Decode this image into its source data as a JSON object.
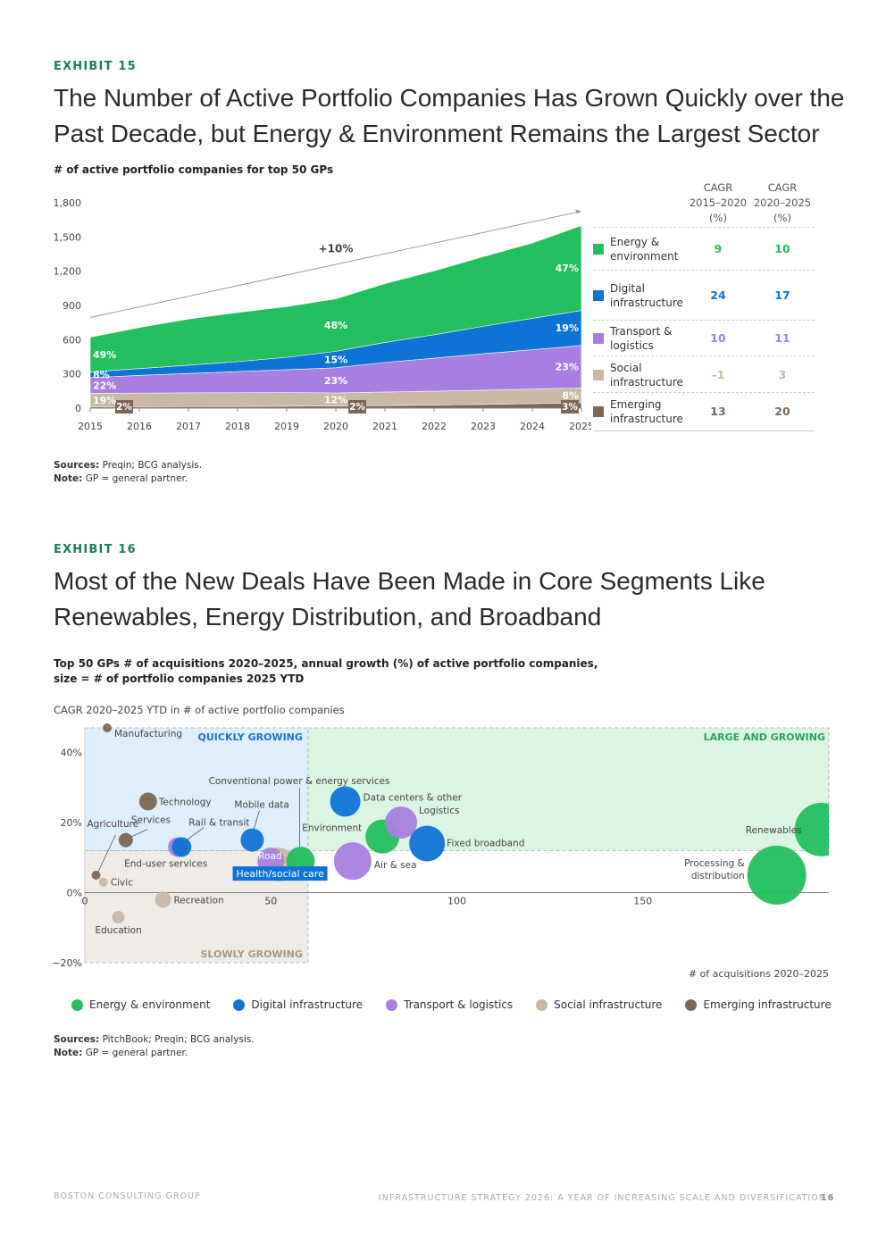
{
  "exhibit15": {
    "tag": "EXHIBIT 15",
    "title_line1": "The Number of Active Portfolio Companies Has Grown Quickly over the",
    "title_line2": "Past Decade, but Energy & Environment Remains the Largest Sector",
    "subtitle": "# of active portfolio companies for top 50 GPs",
    "growth_label": "+10%",
    "table_headers": [
      {
        "l1": "CAGR",
        "l2": "2015–2020",
        "l3": "(%)"
      },
      {
        "l1": "CAGR",
        "l2": "2020–2025",
        "l3": "(%)"
      }
    ],
    "table_rows": [
      {
        "l1": "Energy &",
        "l2": "environment",
        "c1": "9",
        "c2": "10",
        "color": "#22bf5e"
      },
      {
        "l1": "Digital",
        "l2": "infrastructure",
        "c1": "24",
        "c2": "17",
        "color": "#0e73d6"
      },
      {
        "l1": "Transport &",
        "l2": "logistics",
        "c1": "10",
        "c2": "11",
        "color": "#a87fe0"
      },
      {
        "l1": "Social",
        "l2": "infrastructure",
        "c1": "–1",
        "c2": "3",
        "color": "#c8b8a4"
      },
      {
        "l1": "Emerging",
        "l2": "infrastructure",
        "c1": "13",
        "c2": "20",
        "color": "#7d6654"
      }
    ],
    "sources_label": "Sources:",
    "sources_text": "Preqin; BCG analysis.",
    "note_label": "Note:",
    "note_text": "GP = general partner."
  },
  "exhibit16": {
    "tag": "EXHIBIT 16",
    "title_line1": "Most of the New Deals Have Been Made in Core Segments Like",
    "title_line2": "Renewables, Energy Distribution, and Broadband",
    "subtitle_line1": "Top 50 GPs # of acquisitions 2020–2025, annual growth (%) of active portfolio companies,",
    "subtitle_line2": "size = # of portfolio companies 2025 YTD",
    "y_axis_title": "CAGR 2020–2025 YTD in # of active portfolio companies",
    "x_axis_title": "# of acquisitions 2020–2025",
    "zone_quick": "QUICKLY GROWING",
    "zone_large": "LARGE AND GROWING",
    "zone_slow": "SLOWLY GROWING",
    "legend": [
      {
        "label": "Energy & environment",
        "color": "#22bf5e"
      },
      {
        "label": "Digital infrastructure",
        "color": "#0e73d6"
      },
      {
        "label": "Transport & logistics",
        "color": "#a87fe0"
      },
      {
        "label": "Social infrastructure",
        "color": "#c8b8a4"
      },
      {
        "label": "Emerging infrastructure",
        "color": "#7d6654"
      }
    ],
    "sources_label": "Sources:",
    "sources_text": "PitchBook; Preqin; BCG analysis.",
    "note_label": "Note:",
    "note_text": "GP = general partner."
  },
  "footer": {
    "left": "BOSTON CONSULTING GROUP",
    "right": "INFRASTRUCTURE STRATEGY 2026: A YEAR OF INCREASING SCALE AND DIVERSIFICATION",
    "page": "16"
  },
  "chart_data": [
    {
      "type": "area",
      "stacked": true,
      "x": [
        2015,
        2016,
        2017,
        2018,
        2019,
        2020,
        2021,
        2022,
        2023,
        2024,
        2025
      ],
      "ylim": [
        0,
        1800
      ],
      "yticks": [
        0,
        300,
        600,
        900,
        1200,
        1500,
        1800
      ],
      "ytick_labels": [
        "0",
        "300",
        "600",
        "900",
        "1,200",
        "1,500",
        "1,800"
      ],
      "grid": false,
      "series": [
        {
          "name": "Emerging infrastructure",
          "color": "#7d6654",
          "values": [
            12,
            13,
            14,
            15,
            17,
            19,
            23,
            27,
            33,
            40,
            48
          ],
          "labels": {
            "2015": "2%",
            "2020": "2%",
            "2025": "3%"
          }
        },
        {
          "name": "Social infrastructure",
          "color": "#c8b8a4",
          "values": [
            118,
            119,
            120,
            120,
            120,
            114,
            118,
            121,
            124,
            127,
            129
          ],
          "labels": {
            "2015": "19%",
            "2020": "12%",
            "2025": "8%"
          }
        },
        {
          "name": "Transport & logistics",
          "color": "#a87fe0",
          "values": [
            137,
            155,
            170,
            185,
            200,
            221,
            260,
            290,
            320,
            345,
            372
          ],
          "labels": {
            "2015": "22%",
            "2020": "23%",
            "2025": "23%"
          }
        },
        {
          "name": "Digital infrastructure",
          "color": "#0e73d6",
          "values": [
            50,
            60,
            72,
            88,
            108,
            144,
            175,
            205,
            240,
            275,
            307
          ],
          "labels": {
            "2015": "8%",
            "2020": "15%",
            "2025": "19%"
          }
        },
        {
          "name": "Energy & environment",
          "color": "#22bf5e",
          "values": [
            305,
            360,
            405,
            430,
            445,
            460,
            515,
            560,
            610,
            660,
            744
          ],
          "labels": {
            "2015": "49%",
            "2020": "48%",
            "2025": "47%"
          }
        }
      ],
      "annotation": "+10%"
    },
    {
      "type": "scatter",
      "bubble": true,
      "xlabel": "# of acquisitions 2020–2025",
      "ylabel": "CAGR 2020–2025 YTD in # of active portfolio companies",
      "xlim": [
        0,
        200
      ],
      "ylim": [
        -20,
        47
      ],
      "xticks": [
        0,
        50,
        100,
        150
      ],
      "yticks": [
        -20,
        0,
        20,
        40
      ],
      "ytick_labels": [
        "−20%",
        "0%",
        "20%",
        "40%"
      ],
      "points": [
        {
          "label": "Manufacturing",
          "sector": "Emerging infrastructure",
          "x": 6,
          "y": 47,
          "size": 5
        },
        {
          "label": "Technology",
          "sector": "Emerging infrastructure",
          "x": 17,
          "y": 26,
          "size": 10
        },
        {
          "label": "Agriculture",
          "sector": "Emerging infrastructure",
          "x": 3,
          "y": 5,
          "size": 5
        },
        {
          "label": "Services",
          "sector": "Emerging infrastructure",
          "x": 11,
          "y": 15,
          "size": 8
        },
        {
          "label": "Civic",
          "sector": "Social infrastructure",
          "x": 5,
          "y": 3,
          "size": 5
        },
        {
          "label": "Education",
          "sector": "Social infrastructure",
          "x": 9,
          "y": -7,
          "size": 7
        },
        {
          "label": "Recreation",
          "sector": "Social infrastructure",
          "x": 21,
          "y": -2,
          "size": 9
        },
        {
          "label": "Health/social care",
          "sector": "Social infrastructure",
          "x": 52,
          "y": 8,
          "size": 19
        },
        {
          "label": "End-user services",
          "sector": "Transport & logistics",
          "x": 25,
          "y": 13,
          "size": 11
        },
        {
          "label": "Rail & transit",
          "sector": "Digital infrastructure",
          "x": 26,
          "y": 13,
          "size": 11
        },
        {
          "label": "Mobile data",
          "sector": "Digital infrastructure",
          "x": 45,
          "y": 15,
          "size": 13
        },
        {
          "label": "Road",
          "sector": "Transport & logistics",
          "x": 50,
          "y": 9,
          "size": 15
        },
        {
          "label": "Conventional power & energy services",
          "sector": "Energy & environment",
          "x": 58,
          "y": 9,
          "size": 16
        },
        {
          "label": "Data centers & other",
          "sector": "Digital infrastructure",
          "x": 70,
          "y": 26,
          "size": 17
        },
        {
          "label": "Environment",
          "sector": "Energy & environment",
          "x": 80,
          "y": 16,
          "size": 19
        },
        {
          "label": "Logistics",
          "sector": "Transport & logistics",
          "x": 85,
          "y": 20,
          "size": 18
        },
        {
          "label": "Air & sea",
          "sector": "Transport & logistics",
          "x": 72,
          "y": 9,
          "size": 21
        },
        {
          "label": "Fixed broadband",
          "sector": "Digital infrastructure",
          "x": 92,
          "y": 14,
          "size": 20
        },
        {
          "label": "Renewables",
          "sector": "Energy & environment",
          "x": 198,
          "y": 18,
          "size": 30
        },
        {
          "label": "Processing & distribution",
          "sector": "Energy & environment",
          "x": 186,
          "y": 5,
          "size": 33
        }
      ]
    }
  ]
}
